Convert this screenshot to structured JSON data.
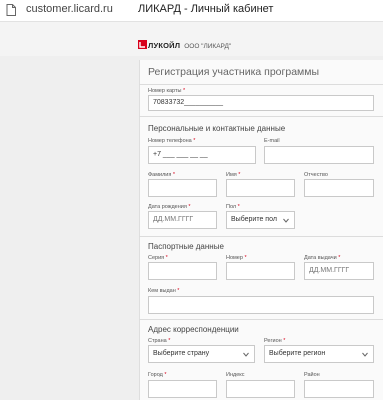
{
  "browser": {
    "url": "customer.licard.ru",
    "page_title": "ЛИКАРД - Личный кабинет"
  },
  "header": {
    "logo_brand": "ЛУКОЙЛ",
    "logo_company": "ООО \"ЛИКАРД\"",
    "colors": {
      "brand_red": "#d8001b"
    }
  },
  "form": {
    "title": "Регистрация участника программы",
    "required_marker": "*",
    "card": {
      "label": "Номер карты",
      "value": "70833732__________"
    },
    "personal": {
      "title": "Персональные и контактные данные",
      "phone_label": "Номер телефона",
      "phone_value": "+7 ___ ___ __ __",
      "email_label": "E-mail",
      "surname_label": "Фамилия",
      "name_label": "Имя",
      "patronymic_label": "Отчество",
      "birthdate_label": "Дата рождения",
      "birthdate_placeholder": "ДД.ММ.ГГГГ",
      "gender_label": "Пол",
      "gender_value": "Выберите пол"
    },
    "passport": {
      "title": "Паспортные данные",
      "series_label": "Серия",
      "number_label": "Номер",
      "issue_date_label": "Дата выдачи",
      "issue_date_placeholder": "ДД.ММ.ГГГГ",
      "issued_by_label": "Кем выдан"
    },
    "address": {
      "title": "Адрес корреспонденции",
      "country_label": "Страна",
      "country_value": "Выберите страну",
      "region_label": "Регион",
      "region_value": "Выберите регион",
      "city_label": "Город",
      "index_label": "Индекс",
      "district_label": "Район"
    }
  }
}
